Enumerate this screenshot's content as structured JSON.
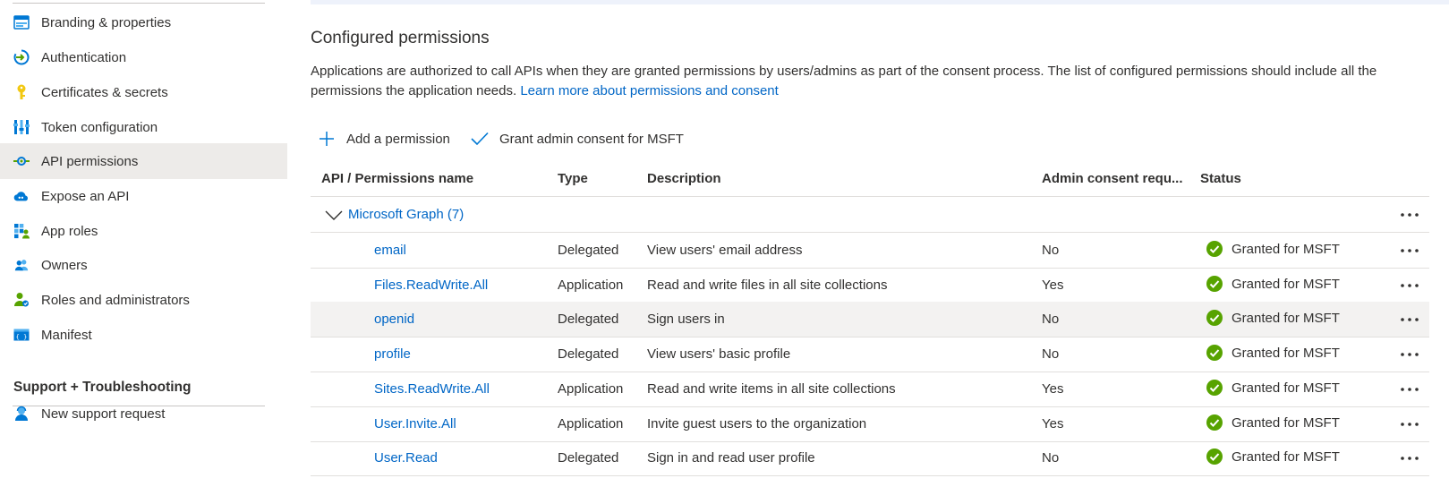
{
  "sidebar": {
    "items": [
      {
        "label": "Branding & properties",
        "icon": "branding-icon"
      },
      {
        "label": "Authentication",
        "icon": "authentication-icon"
      },
      {
        "label": "Certificates & secrets",
        "icon": "key-icon"
      },
      {
        "label": "Token configuration",
        "icon": "token-icon"
      },
      {
        "label": "API permissions",
        "icon": "api-permissions-icon",
        "selected": true
      },
      {
        "label": "Expose an API",
        "icon": "cloud-icon"
      },
      {
        "label": "App roles",
        "icon": "app-roles-icon"
      },
      {
        "label": "Owners",
        "icon": "owners-icon"
      },
      {
        "label": "Roles and administrators",
        "icon": "roles-icon"
      },
      {
        "label": "Manifest",
        "icon": "manifest-icon"
      }
    ],
    "support_heading": "Support + Troubleshooting",
    "support_items": [
      {
        "label": "New support request",
        "icon": "support-person-icon"
      }
    ]
  },
  "main": {
    "title": "Configured permissions",
    "description": "Applications are authorized to call APIs when they are granted permissions by users/admins as part of the consent process. The list of configured permissions should include all the permissions the application needs.",
    "learn_more_link": "Learn more about permissions and consent",
    "commands": {
      "add_permission": "Add a permission",
      "grant_consent": "Grant admin consent for MSFT"
    },
    "table": {
      "columns": [
        "API / Permissions name",
        "Type",
        "Description",
        "Admin consent requ...",
        "Status"
      ],
      "group": {
        "label": "Microsoft Graph (7)"
      },
      "rows": [
        {
          "name": "email",
          "type": "Delegated",
          "description": "View users' email address",
          "admin_consent": "No",
          "status": "Granted for MSFT"
        },
        {
          "name": "Files.ReadWrite.All",
          "type": "Application",
          "description": "Read and write files in all site collections",
          "admin_consent": "Yes",
          "status": "Granted for MSFT"
        },
        {
          "name": "openid",
          "type": "Delegated",
          "description": "Sign users in",
          "admin_consent": "No",
          "status": "Granted for MSFT"
        },
        {
          "name": "profile",
          "type": "Delegated",
          "description": "View users' basic profile",
          "admin_consent": "No",
          "status": "Granted for MSFT"
        },
        {
          "name": "Sites.ReadWrite.All",
          "type": "Application",
          "description": "Read and write items in all site collections",
          "admin_consent": "Yes",
          "status": "Granted for MSFT"
        },
        {
          "name": "User.Invite.All",
          "type": "Application",
          "description": "Invite guest users to the organization",
          "admin_consent": "Yes",
          "status": "Granted for MSFT"
        },
        {
          "name": "User.Read",
          "type": "Delegated",
          "description": "Sign in and read user profile",
          "admin_consent": "No",
          "status": "Granted for MSFT"
        }
      ]
    }
  },
  "colors": {
    "link": "#0066c6",
    "success": "#57a300",
    "selected_bg": "#edebe9",
    "row_highlight": "#f3f2f1"
  }
}
